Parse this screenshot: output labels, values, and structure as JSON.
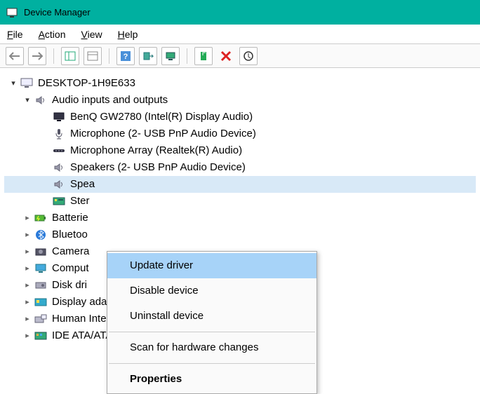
{
  "titlebar": {
    "title": "Device Manager"
  },
  "menubar": {
    "file": "File",
    "action": "Action",
    "view": "View",
    "help": "Help"
  },
  "tree": {
    "root": "DESKTOP-1H9E633",
    "audio_category": "Audio inputs and outputs",
    "audio_children": {
      "0": "BenQ GW2780 (Intel(R) Display Audio)",
      "1": "Microphone (2- USB PnP Audio Device)",
      "2": "Microphone Array (Realtek(R) Audio)",
      "3": "Speakers (2- USB PnP Audio Device)",
      "4": "Spea",
      "5": "Ster"
    },
    "collapsed": {
      "batteries": "Batterie",
      "bluetooth": "Bluetoo",
      "cameras": "Camera",
      "computer": "Comput",
      "diskdrives": "Disk dri",
      "display": "Display adapters",
      "hid": "Human Interface Devices",
      "ide": "IDE ATA/ATAPI controllers"
    }
  },
  "context_menu": {
    "update": "Update driver",
    "disable": "Disable device",
    "uninstall": "Uninstall device",
    "scan": "Scan for hardware changes",
    "properties": "Properties"
  }
}
